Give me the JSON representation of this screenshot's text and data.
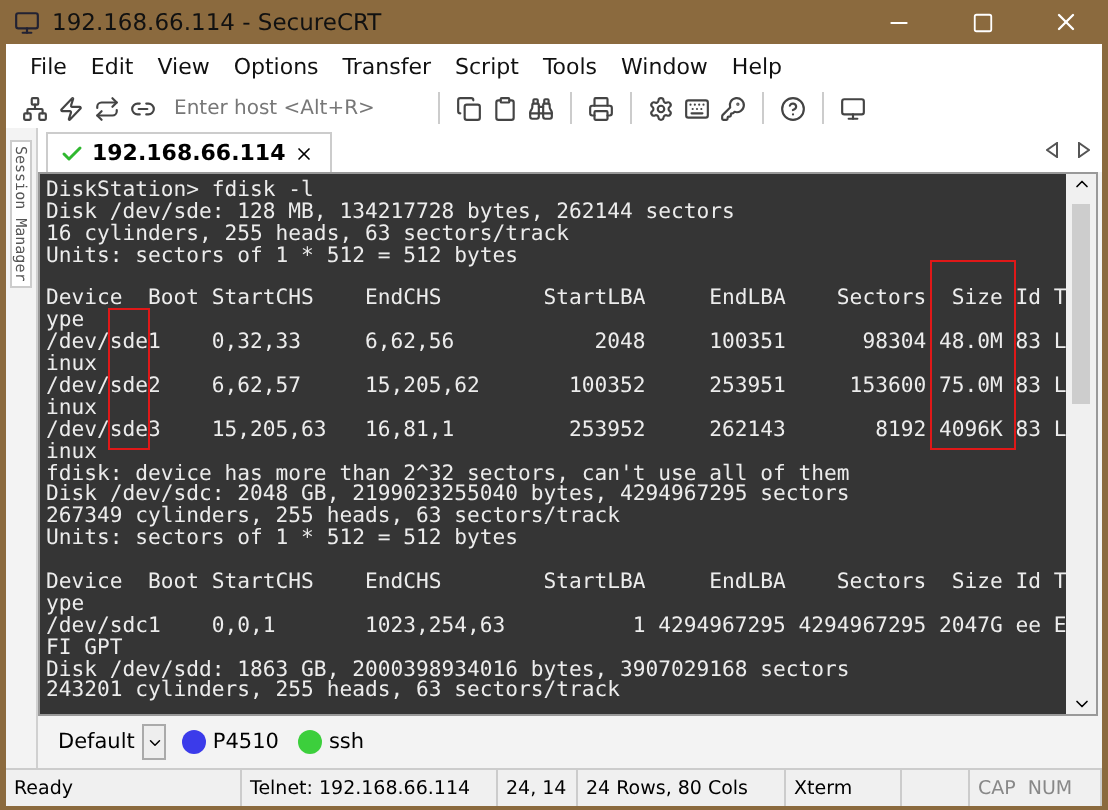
{
  "window": {
    "title": "192.168.66.114 - SecureCRT"
  },
  "menu": [
    "File",
    "Edit",
    "View",
    "Options",
    "Transfer",
    "Script",
    "Tools",
    "Window",
    "Help"
  ],
  "toolbar": {
    "host_placeholder": "Enter host <Alt+R>"
  },
  "tabs": [
    {
      "label": "192.168.66.114",
      "selected": true,
      "connected": true
    }
  ],
  "side_panel": {
    "label": "Session Manager"
  },
  "terminal": {
    "blocks": [
      [
        "DiskStation> fdisk -l",
        "Disk /dev/sde: 128 MB, 134217728 bytes, 262144 sectors",
        "16 cylinders, 255 heads, 63 sectors/track",
        "Units: sectors of 1 * 512 = 512 bytes"
      ],
      [
        "Device  Boot StartCHS    EndCHS        StartLBA     EndLBA    Sectors  Size Id T",
        "ype",
        "/dev/sde1    0,32,33     6,62,56           2048     100351      98304 48.0M 83 L",
        "inux",
        "/dev/sde2    6,62,57     15,205,62       100352     253951     153600 75.0M 83 L",
        "inux",
        "/dev/sde3    15,205,63   16,81,1         253952     262143       8192 4096K 83 L",
        "inux",
        "fdisk: device has more than 2^32 sectors, can't use all of them",
        "Disk /dev/sdc: 2048 GB, 2199023255040 bytes, 4294967295 sectors",
        "267349 cylinders, 255 heads, 63 sectors/track",
        "Units: sectors of 1 * 512 = 512 bytes"
      ],
      [
        "Device  Boot StartCHS    EndCHS        StartLBA     EndLBA    Sectors  Size Id T",
        "ype",
        "/dev/sdc1    0,0,1       1023,254,63          1 4294967295 4294967295 2047G ee E",
        "FI GPT",
        "Disk /dev/sdd: 1863 GB, 2000398934016 bytes, 3907029168 sectors",
        "243201 cylinders, 255 heads, 63 sectors/track"
      ]
    ]
  },
  "sessions": {
    "dropdown": "Default",
    "buttons": [
      {
        "label": "P4510",
        "color": "#3b3bea"
      },
      {
        "label": "ssh",
        "color": "#3ccf3c"
      }
    ]
  },
  "status_bar": [
    "Ready",
    "Telnet: 192.168.66.114",
    "24, 14",
    "24 Rows, 80 Cols",
    "Xterm",
    "CAP",
    "NUM"
  ]
}
